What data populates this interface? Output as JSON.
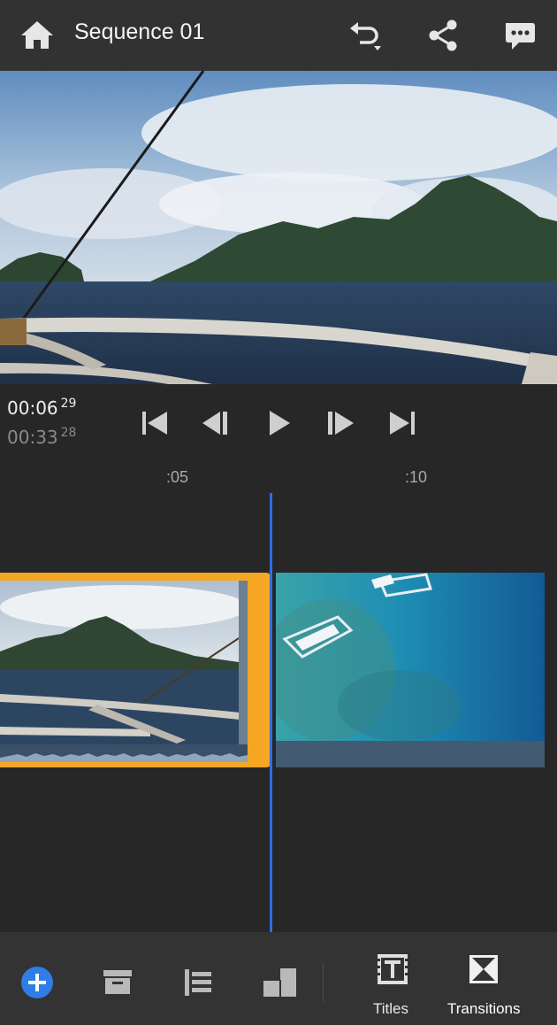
{
  "header": {
    "title": "Sequence 01",
    "icons": [
      "home-icon",
      "undo-icon",
      "share-icon",
      "feedback-icon"
    ]
  },
  "player": {
    "current_time": "00:06",
    "current_frame": "29",
    "duration_time": "00:33",
    "duration_frame": "28",
    "controls": [
      "skip-to-start-icon",
      "step-back-icon",
      "play-icon",
      "step-forward-icon",
      "skip-to-end-icon"
    ]
  },
  "ruler": {
    "ticks": [
      ":05",
      ":10"
    ]
  },
  "timeline": {
    "clips": [
      "boat-island-clip",
      "aerial-reef-clip"
    ],
    "selected_clip": "boat-island-clip"
  },
  "toolbar": {
    "titles_label": "Titles",
    "transitions_label": "Transitions"
  },
  "colors": {
    "accent_blue": "#2f6fe0",
    "selection_orange": "#f5a623",
    "background": "#272727",
    "header": "#323232"
  }
}
